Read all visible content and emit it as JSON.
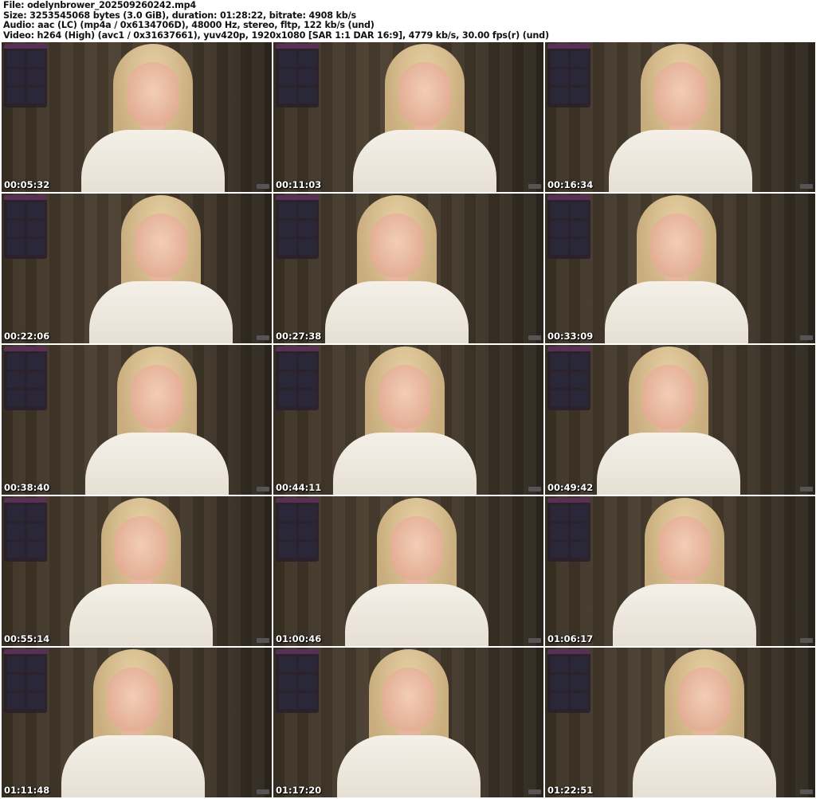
{
  "header": {
    "file": "File: odelynbrower_202509260242.mp4",
    "size": "Size: 3253545068 bytes (3.0 GiB), duration: 01:28:22, bitrate: 4908 kb/s",
    "audio": "Audio: aac (LC) (mp4a / 0x6134706D), 48000 Hz, stereo, fltp, 122 kb/s (und)",
    "video": "Video: h264 (High) (avc1 / 0x31637661), yuv420p, 1920x1080 [SAR 1:1 DAR 16:9], 4779 kb/s, 30.00 fps(r) (und)"
  },
  "thumbnails": [
    {
      "timestamp": "00:05:32"
    },
    {
      "timestamp": "00:11:03"
    },
    {
      "timestamp": "00:16:34"
    },
    {
      "timestamp": "00:22:06"
    },
    {
      "timestamp": "00:27:38"
    },
    {
      "timestamp": "00:33:09"
    },
    {
      "timestamp": "00:38:40"
    },
    {
      "timestamp": "00:44:11"
    },
    {
      "timestamp": "00:49:42"
    },
    {
      "timestamp": "00:55:14"
    },
    {
      "timestamp": "01:00:46"
    },
    {
      "timestamp": "01:06:17"
    },
    {
      "timestamp": "01:11:48"
    },
    {
      "timestamp": "01:17:20"
    },
    {
      "timestamp": "01:22:51"
    }
  ]
}
